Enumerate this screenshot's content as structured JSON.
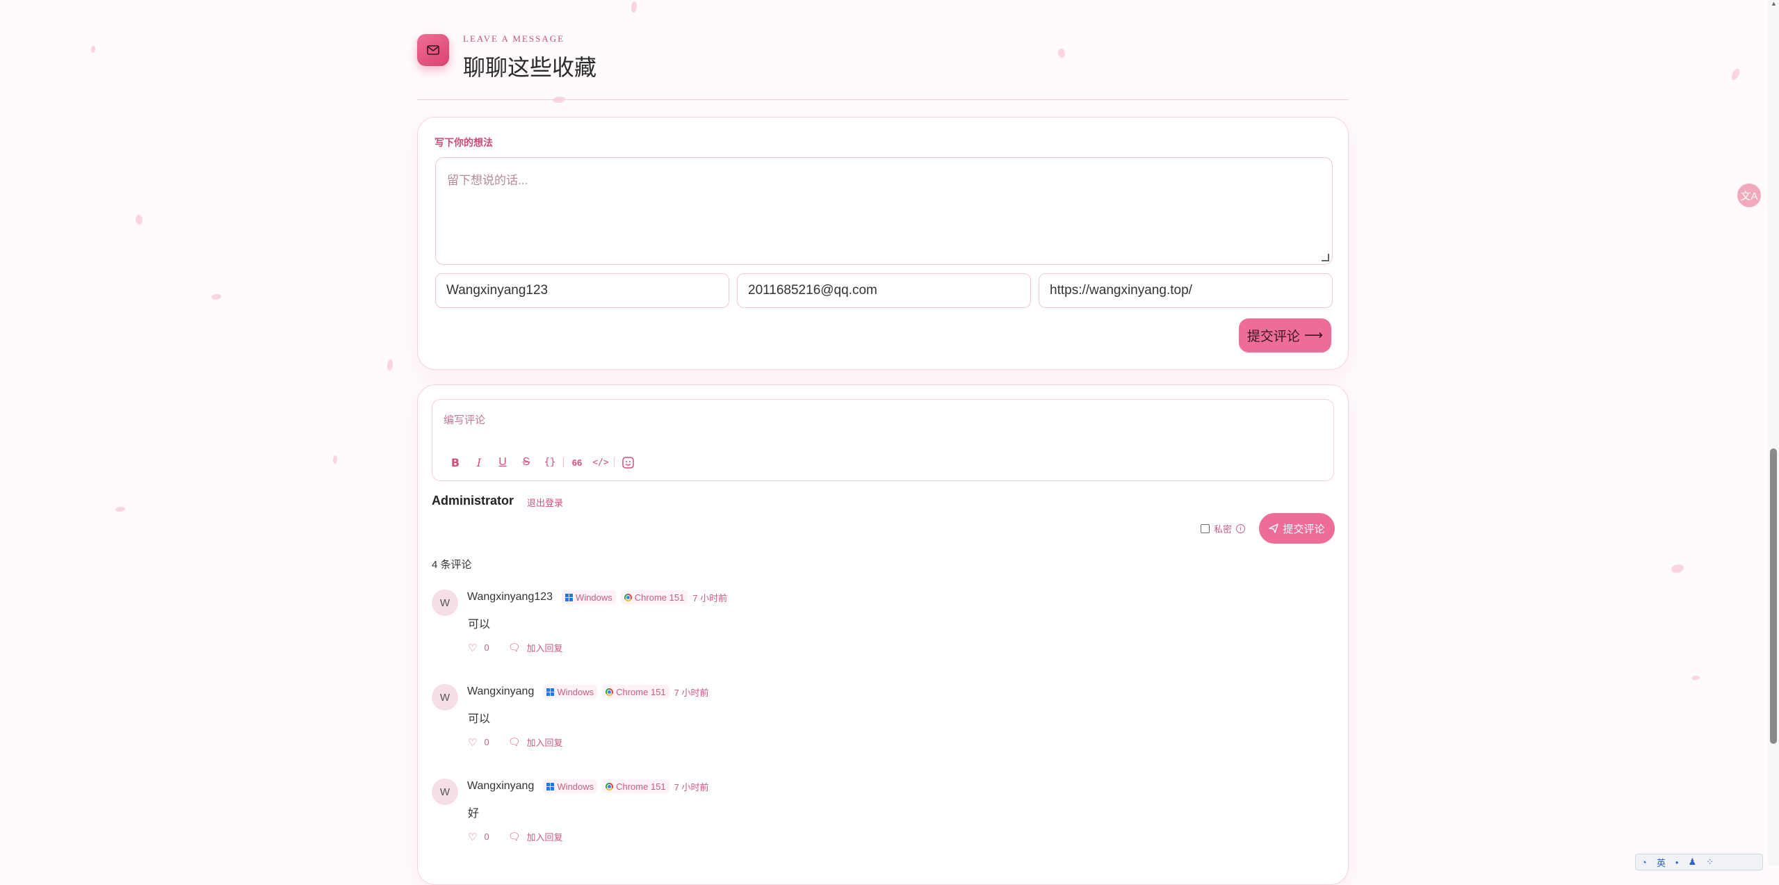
{
  "header": {
    "kicker": "LEAVE A MESSAGE",
    "title": "聊聊这些收藏",
    "icon": "mail-icon"
  },
  "message_form": {
    "label": "写下你的想法",
    "textarea_placeholder": "留下想说的话...",
    "name_value": "Wangxinyang123",
    "email_value": "2011685216@qq.com",
    "url_value": "https://wangxinyang.top/",
    "submit_label": "提交评论"
  },
  "comments": {
    "editor_placeholder": "编写评论",
    "toolbar": [
      "bold-icon",
      "italic-icon",
      "underline-icon",
      "strikethrough-icon",
      "code-block-icon",
      "quote-icon",
      "html-code-icon",
      "emoji-icon"
    ],
    "user": "Administrator",
    "logout_label": "退出登录",
    "private_label": "私密",
    "post_label": "提交评论",
    "count_label": "4 条评论",
    "items": [
      {
        "avatar": "W",
        "nick": "Wangxinyang123",
        "os": "Windows",
        "browser": "Chrome 151",
        "time": "7 小时前",
        "text": "可以",
        "likes": "0",
        "reply_label": "加入回复"
      },
      {
        "avatar": "W",
        "nick": "Wangxinyang",
        "os": "Windows",
        "browser": "Chrome 151",
        "time": "7 小时前",
        "text": "可以",
        "likes": "0",
        "reply_label": "加入回复"
      },
      {
        "avatar": "W",
        "nick": "Wangxinyang",
        "os": "Windows",
        "browser": "Chrome 151",
        "time": "7 小时前",
        "text": "好",
        "likes": "0",
        "reply_label": "加入回复"
      }
    ]
  },
  "side": {
    "translate_icon": "translate-icon",
    "ime_label": "英"
  },
  "colors": {
    "accent": "#ee6d96",
    "accent_dark": "#d9436f",
    "background": "#fffbfc",
    "border": "#f6d3dd"
  }
}
